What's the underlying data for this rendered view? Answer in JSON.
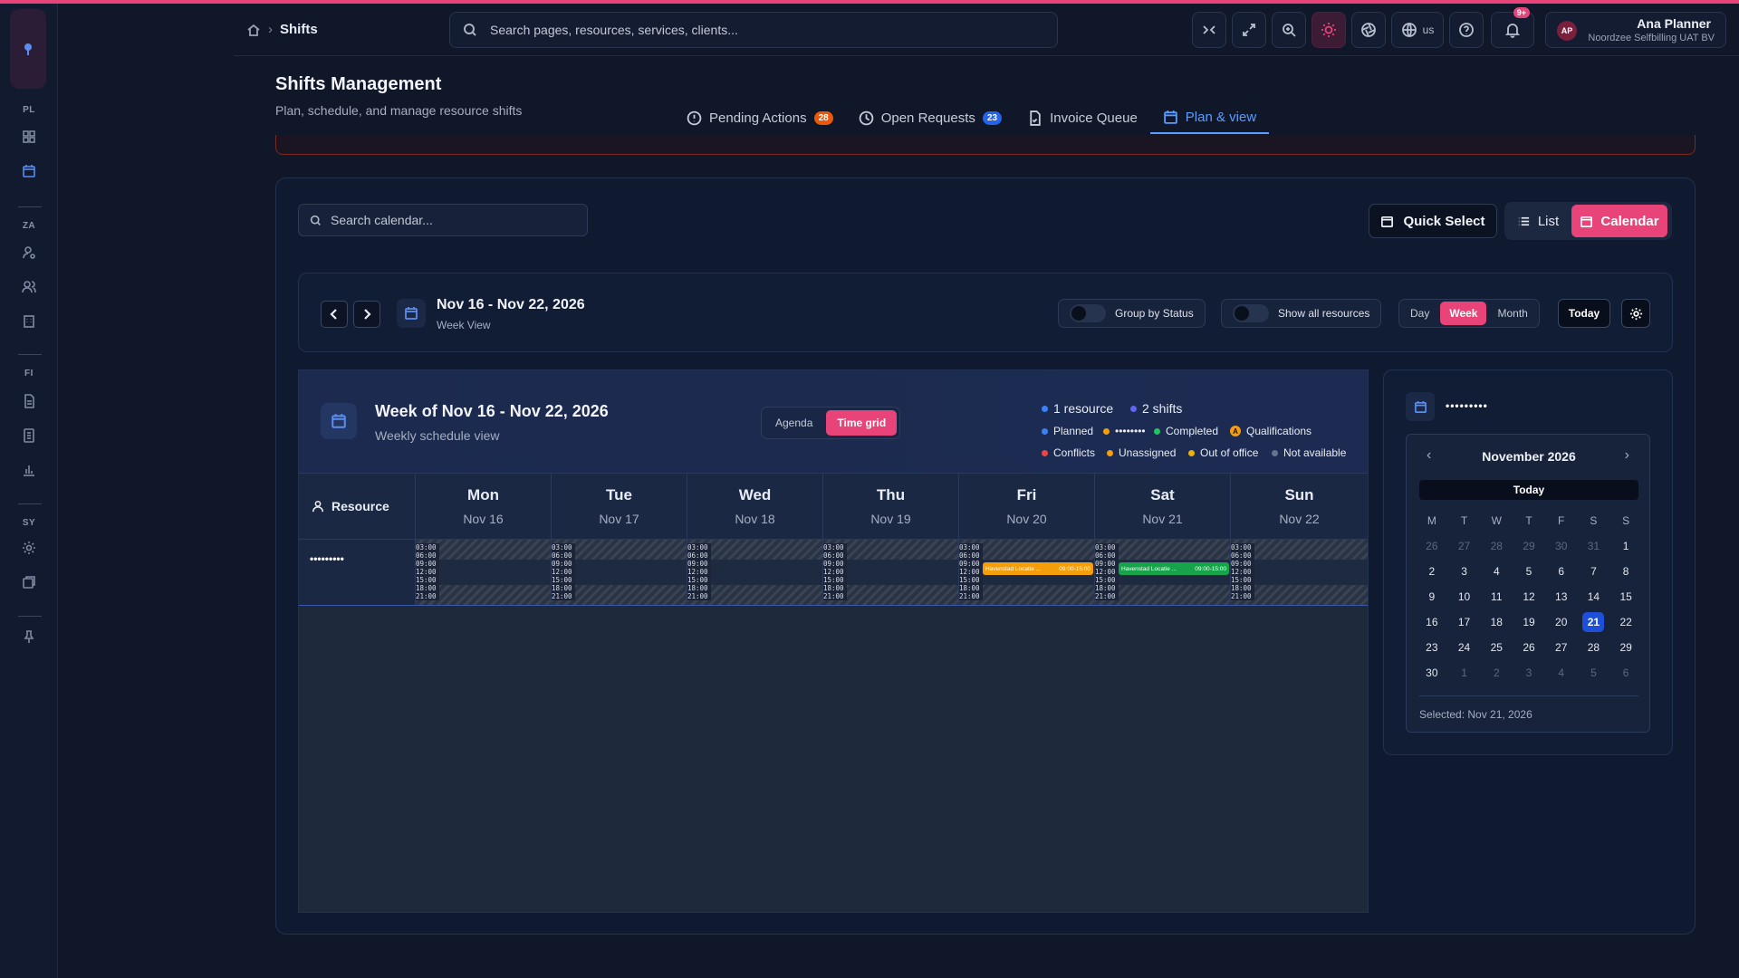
{
  "breadcrumb": {
    "current": "Shifts"
  },
  "search": {
    "placeholder": "Search pages, resources, services, clients..."
  },
  "topbar": {
    "locale": "us",
    "notifications_badge": "9+"
  },
  "user": {
    "initials": "AP",
    "name": "Ana Planner",
    "org": "Noordzee Selfbilling UAT BV"
  },
  "sidebar": {
    "sections": [
      "PL",
      "ZA",
      "FI",
      "SY"
    ]
  },
  "page": {
    "title": "Shifts Management",
    "subtitle": "Plan, schedule, and manage resource shifts"
  },
  "tabs": [
    {
      "label": "Pending Actions",
      "count": "28",
      "count_color": "#ea580c"
    },
    {
      "label": "Open Requests",
      "count": "23",
      "count_color": "#2563eb"
    },
    {
      "label": "Invoice Queue"
    },
    {
      "label": "Plan & view",
      "active": true
    }
  ],
  "toolbar": {
    "search_placeholder": "Search calendar...",
    "quick_select": "Quick Select",
    "list": "List",
    "calendar": "Calendar"
  },
  "nav": {
    "range": "Nov 16 - Nov 22, 2026",
    "view_label": "Week View",
    "group_by_status": "Group by Status",
    "show_all_resources": "Show all resources",
    "day": "Day",
    "week": "Week",
    "month": "Month",
    "today": "Today"
  },
  "week": {
    "title": "Week of Nov 16 - Nov 22, 2026",
    "subtitle": "Weekly schedule view",
    "agenda": "Agenda",
    "time_grid": "Time grid",
    "resources_count": "1 resource",
    "shifts_count": "2 shifts",
    "legend": {
      "planned": "Planned",
      "masked": "••••••••",
      "completed": "Completed",
      "qualifications": "Qualifications",
      "conflicts": "Conflicts",
      "unassigned": "Unassigned",
      "out_of_office": "Out of office",
      "not_available": "Not available"
    },
    "resource_header": "Resource",
    "resource_name": "•••••••••",
    "days": [
      {
        "day": "Mon",
        "date": "Nov 16"
      },
      {
        "day": "Tue",
        "date": "Nov 17"
      },
      {
        "day": "Wed",
        "date": "Nov 18"
      },
      {
        "day": "Thu",
        "date": "Nov 19"
      },
      {
        "day": "Fri",
        "date": "Nov 20"
      },
      {
        "day": "Sat",
        "date": "Nov 21"
      },
      {
        "day": "Sun",
        "date": "Nov 22"
      }
    ],
    "time_labels": "03:00\n06:00\n09:00\n12:00\n15:00\n18:00\n21:00",
    "shifts": [
      {
        "label": "Havenstad Locatie ...",
        "time": "09:00-15:00",
        "color": "#f59e0b"
      },
      {
        "label": "Havenstad Locatie ...",
        "time": "09:00-15:00",
        "color": "#16a34a"
      }
    ]
  },
  "minical": {
    "resource_name": "•••••••••",
    "month": "November 2026",
    "today": "Today",
    "weekdays": [
      "M",
      "T",
      "W",
      "T",
      "F",
      "S",
      "S"
    ],
    "selected_text": "Selected: Nov 21, 2026"
  }
}
